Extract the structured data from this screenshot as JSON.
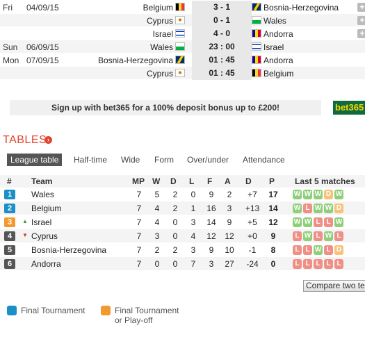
{
  "fixtures": [
    {
      "day": "Fri",
      "date": "04/09/15",
      "home": "Belgium",
      "home_flag": "belgium-flag",
      "score": "3 - 1",
      "away": "Bosnia-Herzegovina",
      "away_flag": "bosnia-flag",
      "plus": "+"
    },
    {
      "day": "",
      "date": "",
      "home": "Cyprus",
      "home_flag": "cyprus-flag",
      "score": "0 - 1",
      "away": "Wales",
      "away_flag": "wales-flag",
      "plus": "+"
    },
    {
      "day": "",
      "date": "",
      "home": "Israel",
      "home_flag": "israel-flag",
      "score": "4 - 0",
      "away": "Andorra",
      "away_flag": "andorra-flag",
      "plus": "+"
    },
    {
      "day": "Sun",
      "date": "06/09/15",
      "home": "Wales",
      "home_flag": "wales-flag",
      "score": "23 : 00",
      "away": "Israel",
      "away_flag": "israel-flag",
      "plus": ""
    },
    {
      "day": "Mon",
      "date": "07/09/15",
      "home": "Bosnia-Herzegovina",
      "home_flag": "bosnia-flag",
      "score": "01 : 45",
      "away": "Andorra",
      "away_flag": "andorra-flag",
      "plus": ""
    },
    {
      "day": "",
      "date": "",
      "home": "Cyprus",
      "home_flag": "cyprus-flag",
      "score": "01 : 45",
      "away": "Belgium",
      "away_flag": "belgium-flag",
      "plus": ""
    }
  ],
  "banner": {
    "text": "Sign up with bet365 for a 100% deposit bonus up to £200!",
    "logo": "bet365"
  },
  "tables_title": "TABLES",
  "tabs": [
    "League table",
    "Half-time",
    "Wide",
    "Form",
    "Over/under",
    "Attendance"
  ],
  "headers": {
    "rank": "#",
    "team": "Team",
    "mp": "MP",
    "w": "W",
    "d": "D",
    "l": "L",
    "f": "F",
    "a": "A",
    "diff": "D",
    "p": "P",
    "last5": "Last 5 matches"
  },
  "rows": [
    {
      "rank": "1",
      "rank_color": "#1b8fc8",
      "trend": "",
      "team": "Wales",
      "mp": "7",
      "w": "5",
      "d": "2",
      "l": "0",
      "f": "9",
      "a": "2",
      "diff": "+7",
      "p": "17",
      "last5": [
        "W",
        "W",
        "W",
        "D",
        "W"
      ]
    },
    {
      "rank": "2",
      "rank_color": "#1b8fc8",
      "trend": "",
      "team": "Belgium",
      "mp": "7",
      "w": "4",
      "d": "2",
      "l": "1",
      "f": "16",
      "a": "3",
      "diff": "+13",
      "p": "14",
      "last5": [
        "W",
        "L",
        "W",
        "W",
        "D"
      ]
    },
    {
      "rank": "3",
      "rank_color": "#f39a2e",
      "trend": "up",
      "team": "Israel",
      "mp": "7",
      "w": "4",
      "d": "0",
      "l": "3",
      "f": "14",
      "a": "9",
      "diff": "+5",
      "p": "12",
      "last5": [
        "W",
        "W",
        "L",
        "L",
        "W"
      ]
    },
    {
      "rank": "4",
      "rank_color": "#555555",
      "trend": "down",
      "team": "Cyprus",
      "mp": "7",
      "w": "3",
      "d": "0",
      "l": "4",
      "f": "12",
      "a": "12",
      "diff": "+0",
      "p": "9",
      "last5": [
        "L",
        "W",
        "L",
        "W",
        "L"
      ]
    },
    {
      "rank": "5",
      "rank_color": "#555555",
      "trend": "",
      "team": "Bosnia-Herzegovina",
      "mp": "7",
      "w": "2",
      "d": "2",
      "l": "3",
      "f": "9",
      "a": "10",
      "diff": "-1",
      "p": "8",
      "last5": [
        "L",
        "L",
        "W",
        "L",
        "D"
      ]
    },
    {
      "rank": "6",
      "rank_color": "#555555",
      "trend": "",
      "team": "Andorra",
      "mp": "7",
      "w": "0",
      "d": "0",
      "l": "7",
      "f": "3",
      "a": "27",
      "diff": "-24",
      "p": "0",
      "last5": [
        "L",
        "L",
        "L",
        "L",
        "L"
      ]
    }
  ],
  "form_colors": {
    "W": "#8fcf7a",
    "D": "#f7c27a",
    "L": "#ef8f86"
  },
  "compare_button": "Compare two teams",
  "legend": [
    {
      "label_1": "Final Tournament",
      "label_2": "",
      "color": "#1b8fc8"
    },
    {
      "label_1": "Final Tournament",
      "label_2": "or Play-off",
      "color": "#f39a2e"
    }
  ]
}
